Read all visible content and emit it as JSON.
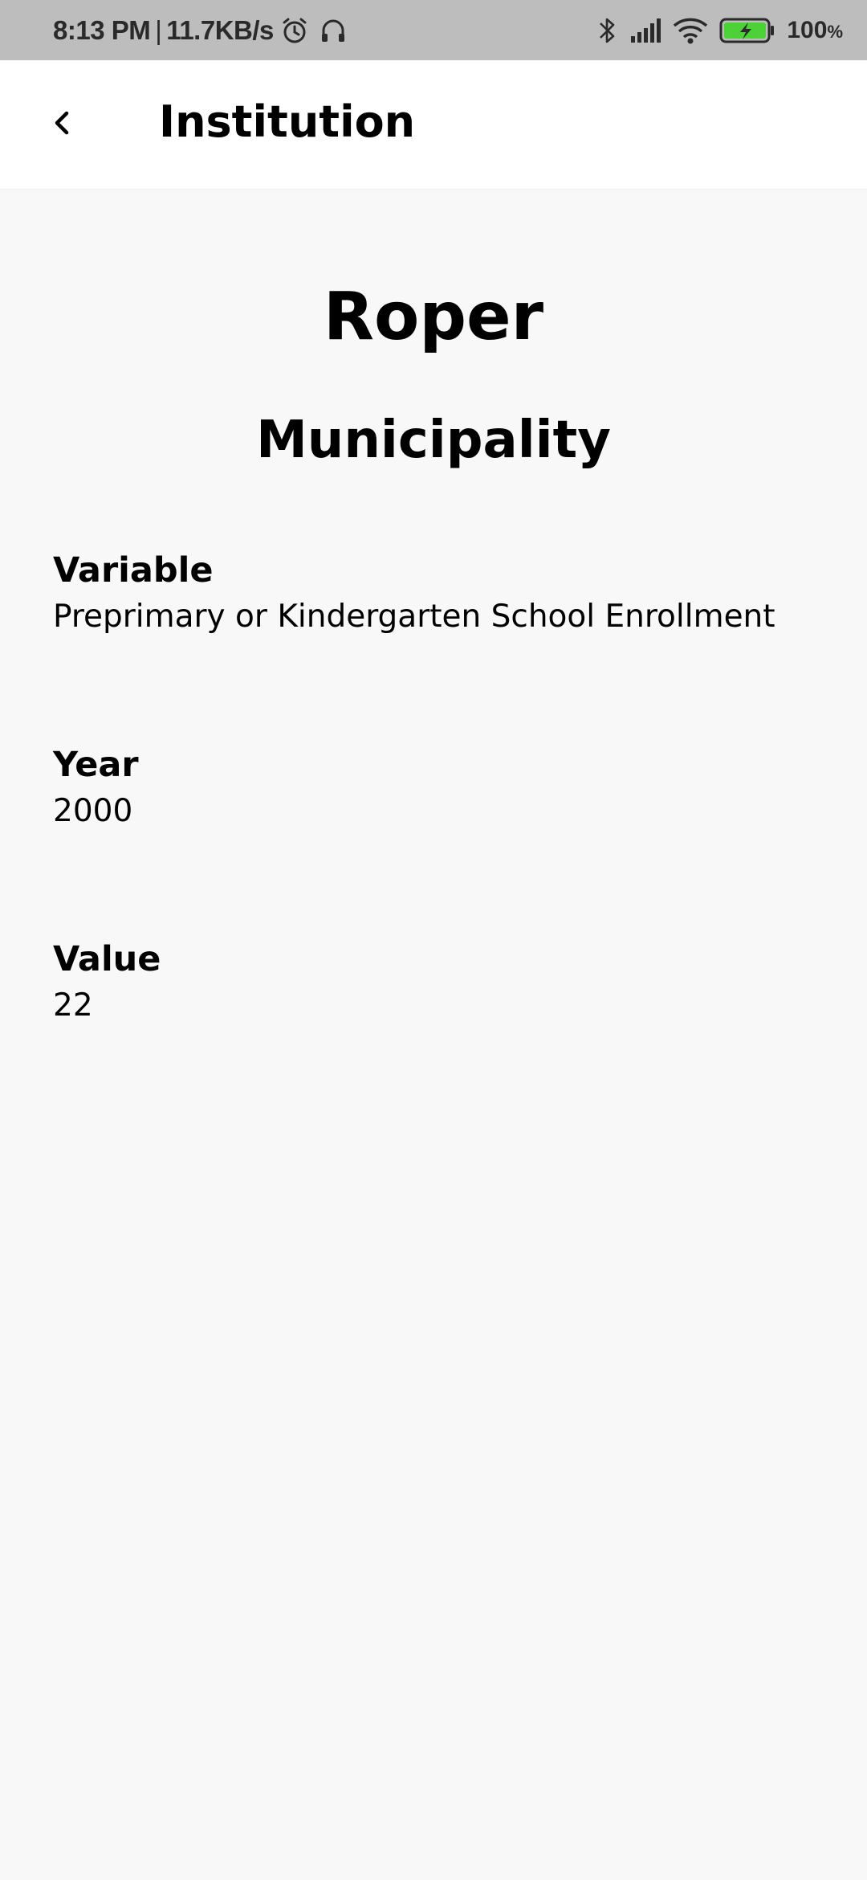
{
  "status_bar": {
    "time": "8:13 PM",
    "separator": "|",
    "speed": "11.7KB/s",
    "battery_percent": "100",
    "battery_unit": "%",
    "icons": [
      "alarm-icon",
      "headset-icon",
      "bluetooth-icon",
      "signal-icon",
      "wifi-icon",
      "battery-charging-icon"
    ],
    "bg_color": "#bdbdbd",
    "battery_color": "#4cd137"
  },
  "app_bar": {
    "back_icon": "chevron-left-icon",
    "title": "Institution"
  },
  "detail": {
    "name": "Roper",
    "type": "Municipality",
    "fields": [
      {
        "label": "Variable",
        "value": "Preprimary or Kindergarten School Enrollment"
      },
      {
        "label": "Year",
        "value": "2000"
      },
      {
        "label": "Value",
        "value": "22"
      }
    ]
  }
}
